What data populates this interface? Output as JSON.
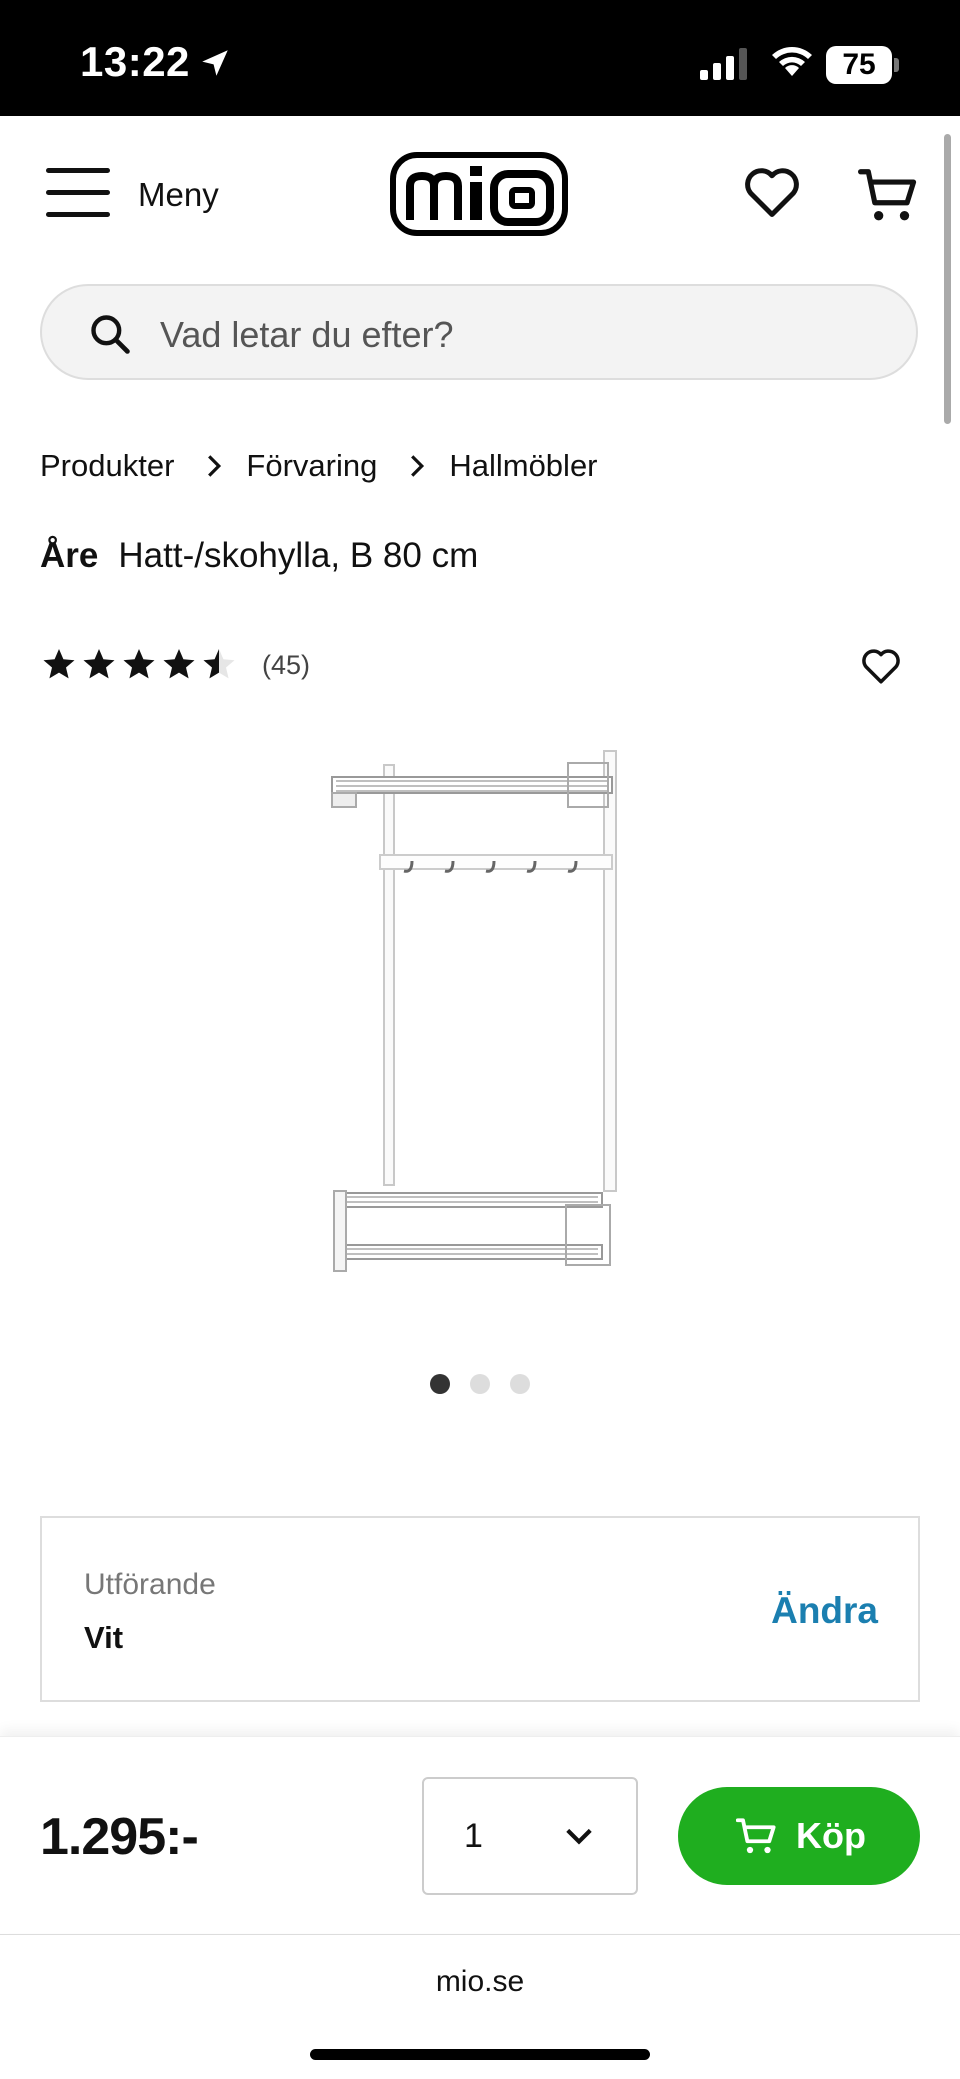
{
  "status_bar": {
    "time": "13:22",
    "battery": "75"
  },
  "header": {
    "menu_label": "Meny",
    "logo_text": "mio"
  },
  "search": {
    "placeholder": "Vad letar du efter?"
  },
  "breadcrumb": [
    "Produkter",
    "Förvaring",
    "Hallmöbler"
  ],
  "product": {
    "brand": "Åre",
    "name": "Hatt-/skohylla, B 80 cm",
    "rating": 4.5,
    "rating_max": 5,
    "review_count": "(45)",
    "image_count": 3,
    "active_image": 1
  },
  "variant": {
    "label": "Utförande",
    "value": "Vit",
    "change_label": "Ändra"
  },
  "buy_bar": {
    "price": "1.295:-",
    "quantity": "1",
    "buy_label": "Köp"
  },
  "browser": {
    "url": "mio.se"
  },
  "colors": {
    "buy_green": "#1fae1f",
    "link_blue": "#1b7fb0"
  }
}
